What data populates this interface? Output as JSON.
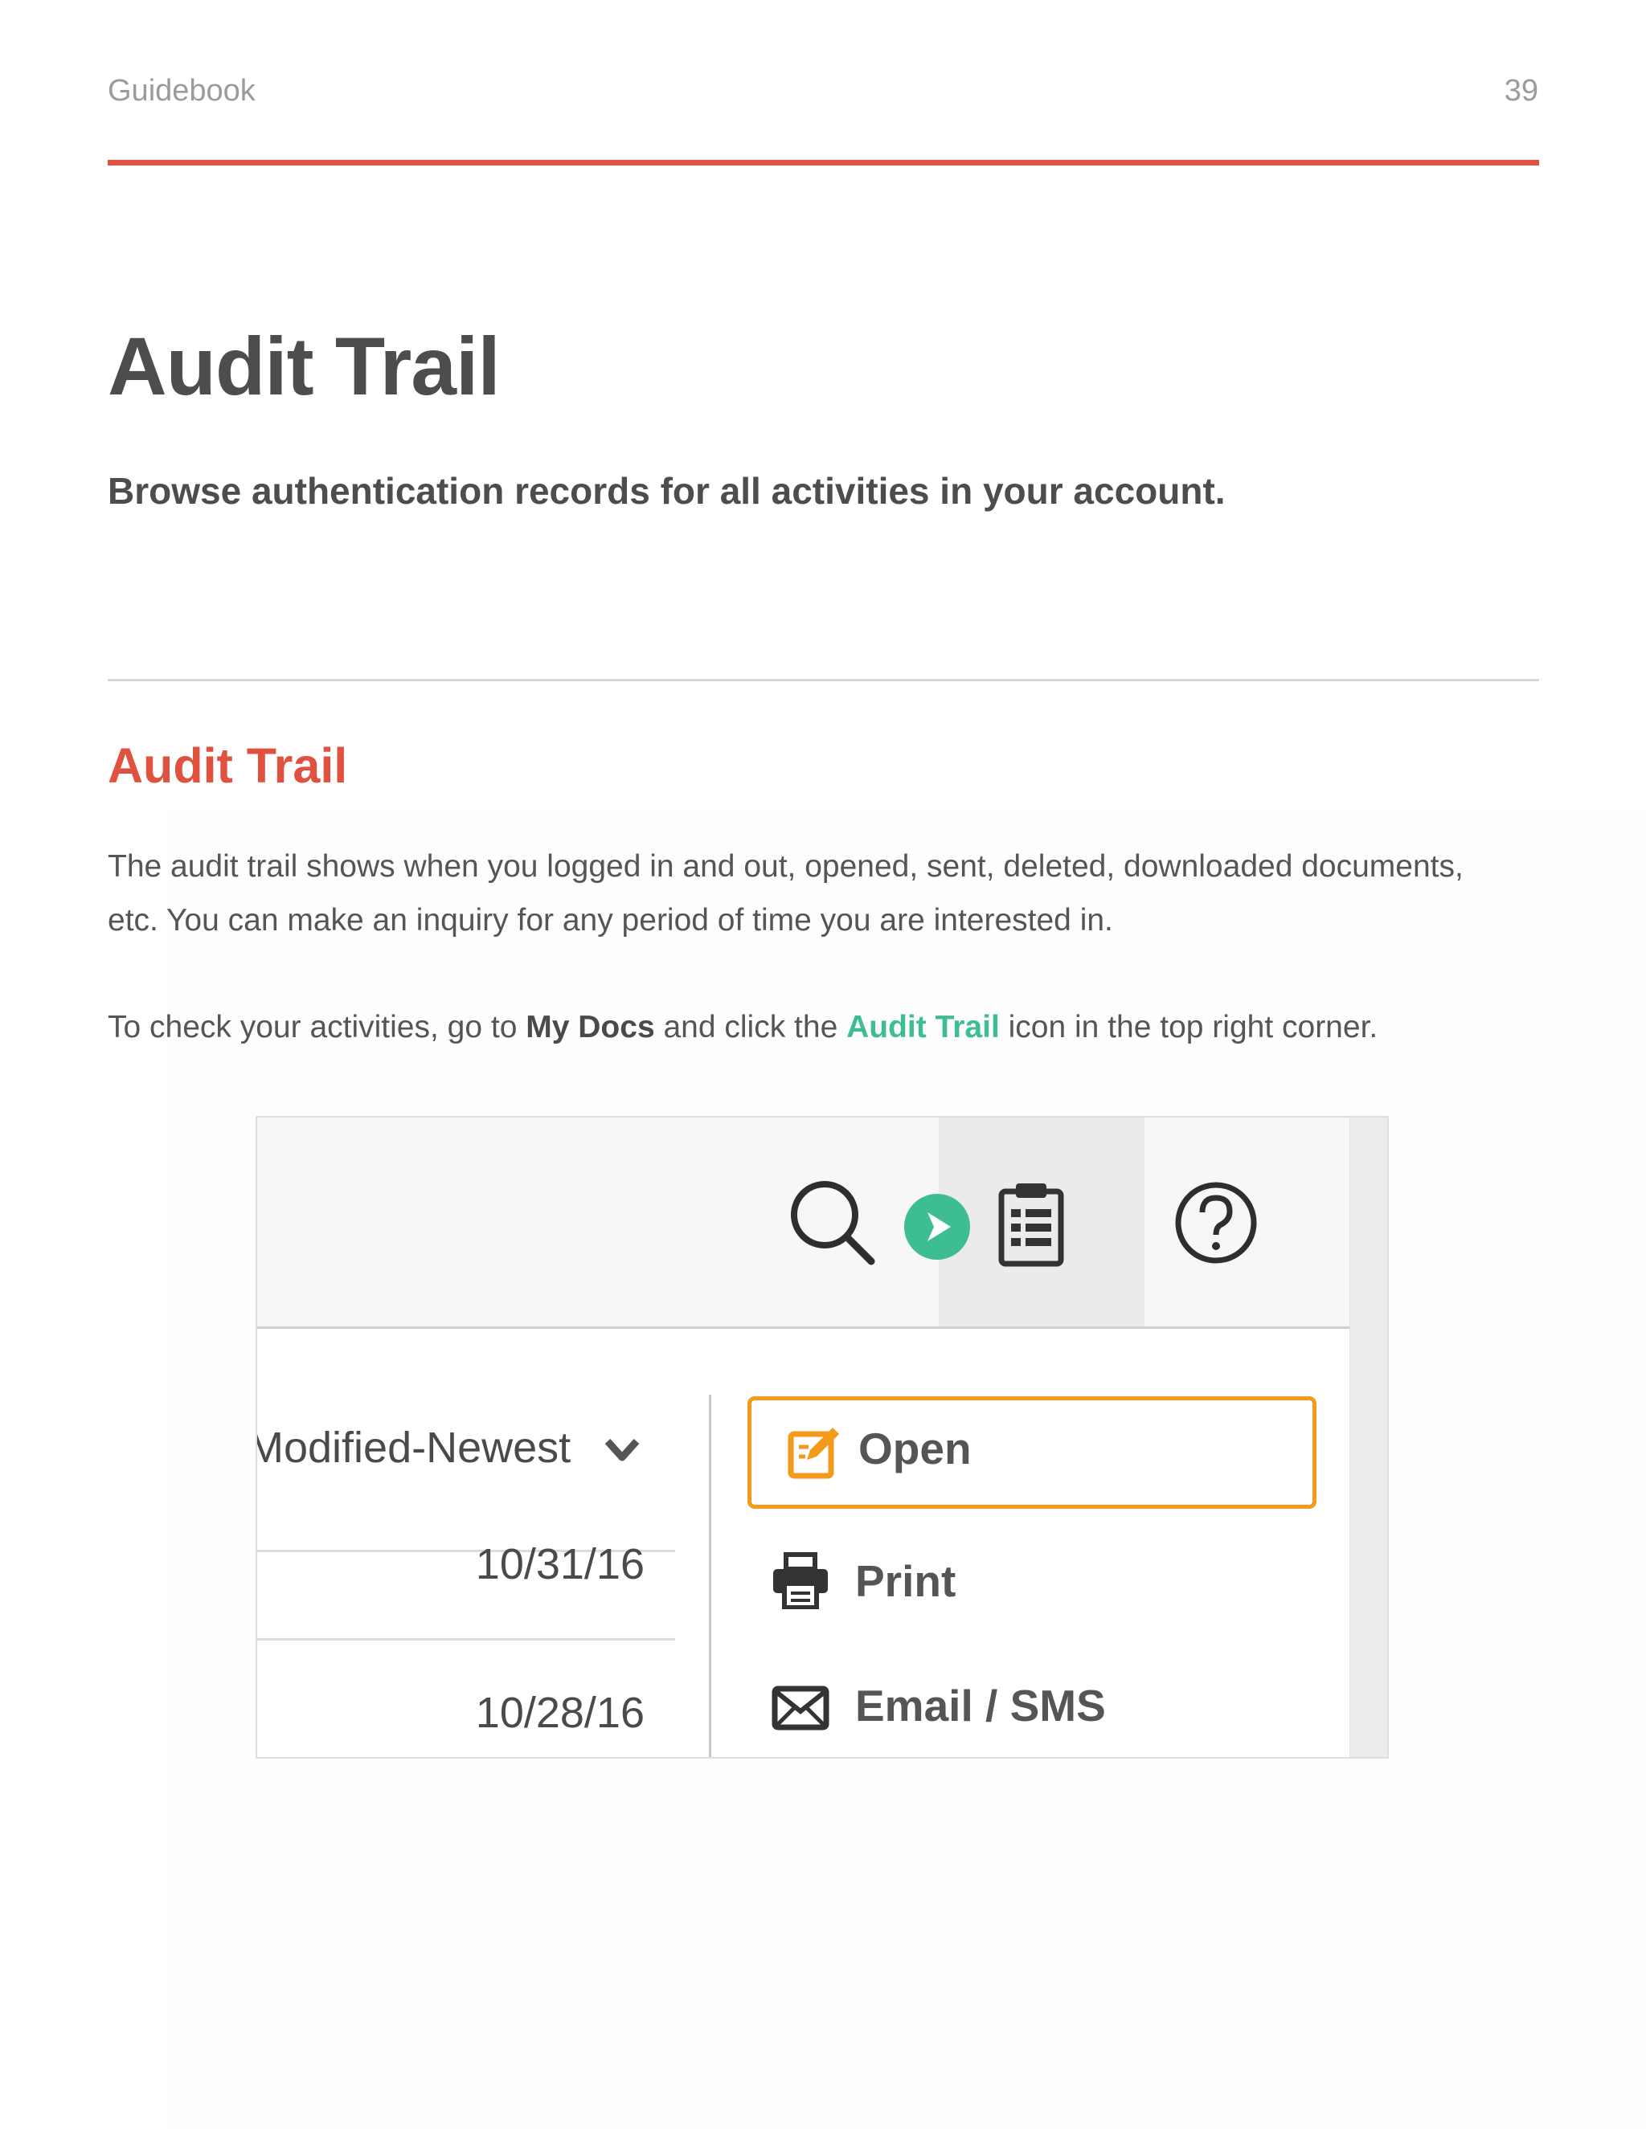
{
  "header": {
    "left": "Guidebook",
    "page_number": "39"
  },
  "title": "Audit Trail",
  "subtitle": "Browse authentication records for all activities in your account.",
  "section": {
    "title": "Audit Trail",
    "paragraph1": "The audit trail shows when you logged in and out, opened, sent, deleted, downloaded documents, etc. You can make an inquiry for any period of time you are interested in.",
    "p2_before": "To check your activities, go to ",
    "p2_bold": "My Docs",
    "p2_middle": " and click the ",
    "p2_link": "Audit Trail",
    "p2_after": " icon in the top right corner."
  },
  "screenshot": {
    "toolbar_icons": [
      "search-icon",
      "arrow-right-icon",
      "clipboard-icon",
      "help-icon"
    ],
    "sort_label": "Modified-Newest",
    "dates": [
      "10/31/16",
      "10/28/16"
    ],
    "menu": {
      "open": "Open",
      "print": "Print",
      "email_sms": "Email / SMS"
    }
  },
  "colors": {
    "accent_red": "#e0513f",
    "link_green": "#3dbd91",
    "highlight_orange": "#f39a1b"
  }
}
